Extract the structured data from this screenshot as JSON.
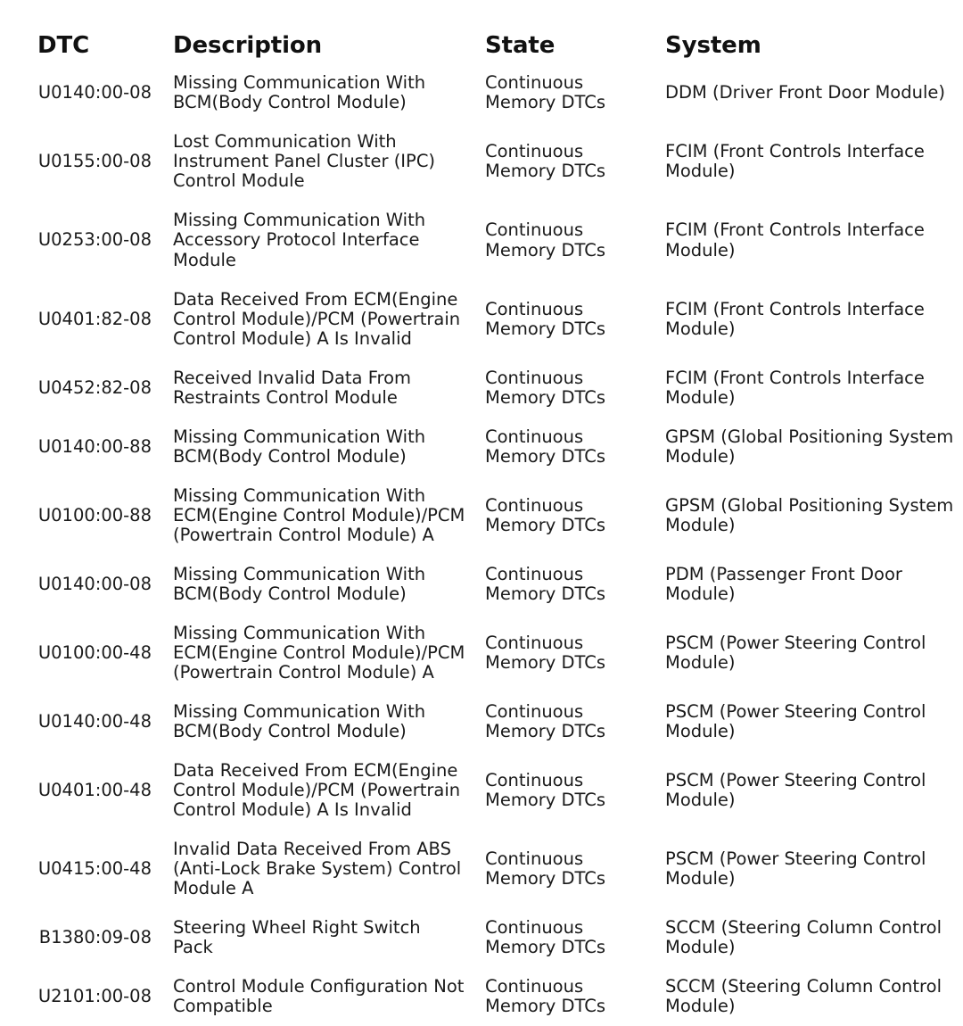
{
  "table": {
    "columns": [
      {
        "key": "dtc",
        "label": "DTC"
      },
      {
        "key": "description",
        "label": "Description"
      },
      {
        "key": "state",
        "label": "State"
      },
      {
        "key": "system",
        "label": "System"
      }
    ],
    "rows": [
      {
        "dtc": "U0140:00-08",
        "description": "Missing Communication With BCM(Body Control Module)",
        "state": "Continuous Memory DTCs",
        "system": "DDM (Driver Front Door Module)"
      },
      {
        "dtc": "U0155:00-08",
        "description": "Lost Communication With Instrument Panel Cluster (IPC) Control Module",
        "state": "Continuous Memory DTCs",
        "system": "FCIM (Front Controls Interface Module)"
      },
      {
        "dtc": "U0253:00-08",
        "description": "Missing Communication With Accessory Protocol Interface Module",
        "state": "Continuous Memory DTCs",
        "system": "FCIM (Front Controls Interface Module)"
      },
      {
        "dtc": "U0401:82-08",
        "description": "Data Received From ECM(Engine Control Module)/PCM (Powertrain Control Module) A Is Invalid",
        "state": "Continuous Memory DTCs",
        "system": "FCIM (Front Controls Interface Module)"
      },
      {
        "dtc": "U0452:82-08",
        "description": "Received Invalid Data From Restraints Control Module",
        "state": "Continuous Memory DTCs",
        "system": "FCIM (Front Controls Interface Module)"
      },
      {
        "dtc": "U0140:00-88",
        "description": "Missing Communication With BCM(Body Control Module)",
        "state": "Continuous Memory DTCs",
        "system": "GPSM (Global Positioning System Module)"
      },
      {
        "dtc": "U0100:00-88",
        "description": "Missing Communication With ECM(Engine Control Module)/PCM (Powertrain Control Module) A",
        "state": "Continuous Memory DTCs",
        "system": "GPSM (Global Positioning System Module)"
      },
      {
        "dtc": "U0140:00-08",
        "description": "Missing Communication With BCM(Body Control Module)",
        "state": "Continuous Memory DTCs",
        "system": "PDM (Passenger Front Door Module)"
      },
      {
        "dtc": "U0100:00-48",
        "description": "Missing Communication With ECM(Engine Control Module)/PCM (Powertrain Control Module) A",
        "state": "Continuous Memory DTCs",
        "system": "PSCM (Power Steering Control Module)"
      },
      {
        "dtc": "U0140:00-48",
        "description": "Missing Communication With BCM(Body Control Module)",
        "state": "Continuous Memory DTCs",
        "system": "PSCM (Power Steering Control Module)"
      },
      {
        "dtc": "U0401:00-48",
        "description": "Data Received From ECM(Engine Control Module)/PCM (Powertrain Control Module) A Is Invalid",
        "state": "Continuous Memory DTCs",
        "system": "PSCM (Power Steering Control Module)"
      },
      {
        "dtc": "U0415:00-48",
        "description": "Invalid Data Received From ABS (Anti-Lock Brake System) Control Module A",
        "state": "Continuous Memory DTCs",
        "system": "PSCM (Power Steering Control Module)"
      },
      {
        "dtc": "B1380:09-08",
        "description": "Steering Wheel Right Switch Pack",
        "state": "Continuous Memory DTCs",
        "system": "SCCM (Steering Column Control Module)"
      },
      {
        "dtc": "U2101:00-08",
        "description": "Control Module Configuration Not Compatible",
        "state": "Continuous Memory DTCs",
        "system": "SCCM (Steering Column Control Module)"
      }
    ]
  },
  "style": {
    "background": "#ffffff",
    "text_color": "#1a1a1a",
    "header_color": "#111111"
  }
}
